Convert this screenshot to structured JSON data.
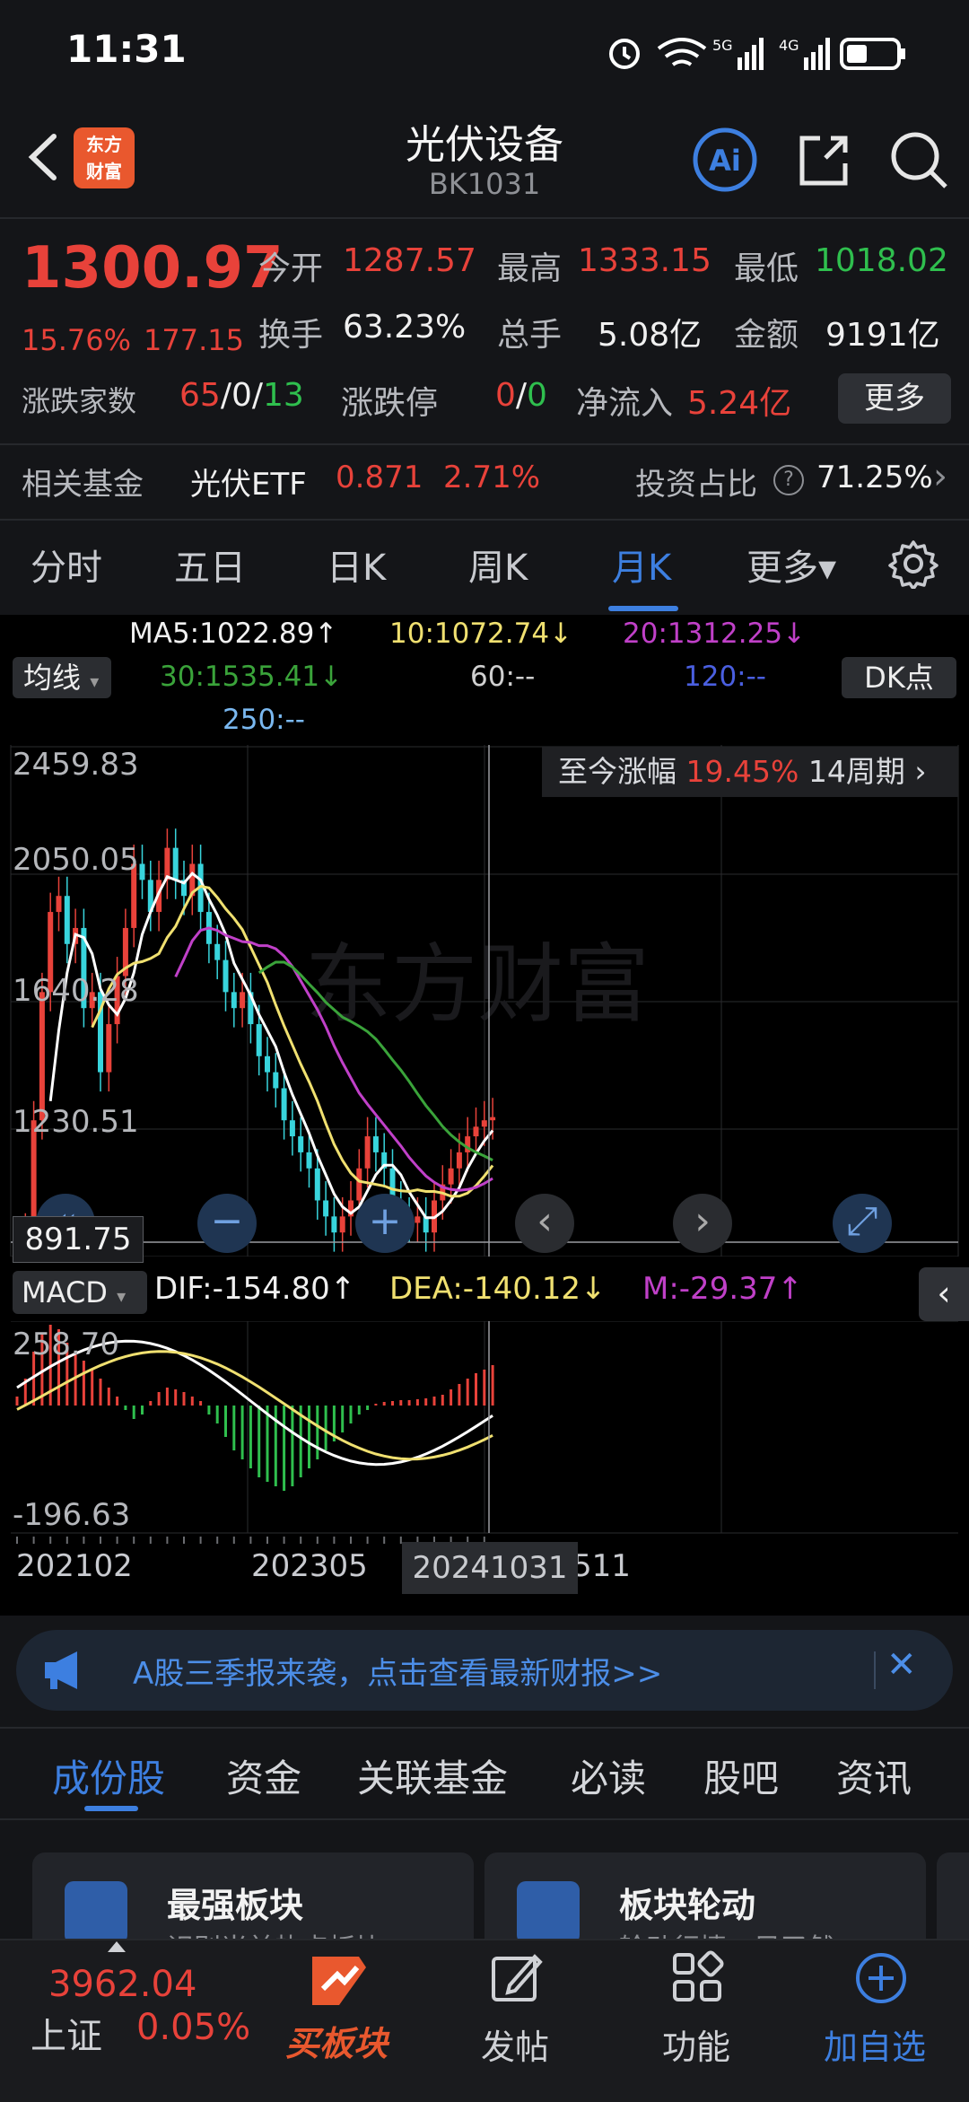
{
  "status": {
    "time": "11:31"
  },
  "header": {
    "title": "光伏设备",
    "code": "BK1031",
    "logo_line1": "东方",
    "logo_line2": "财富",
    "ai_label": "Ai"
  },
  "quote": {
    "price": "1300.97",
    "change_pct": "15.76%",
    "change": "177.15",
    "open_label": "今开",
    "open": "1287.57",
    "high_label": "最高",
    "high": "1333.15",
    "low_label": "最低",
    "low": "1018.02",
    "turnover_label": "换手",
    "turnover": "63.23%",
    "volume_label": "总手",
    "volume": "5.08亿",
    "amount_label": "金额",
    "amount": "9191亿",
    "breadth_label": "涨跌家数",
    "up_count": "65",
    "flat_count": "0",
    "down_count": "13",
    "sep": "/",
    "limit_label": "涨跌停",
    "limit_up": "0",
    "limit_down": "0",
    "netflow_label": "净流入",
    "netflow": "5.24亿",
    "more_button": "更多"
  },
  "fund": {
    "label": "相关基金",
    "name": "光伏ETF",
    "price": "0.871",
    "pct": "2.71%",
    "ratio_label": "投资占比",
    "help": "?",
    "ratio": "71.25%",
    "arrow": "›"
  },
  "period_tabs": [
    "分时",
    "五日",
    "日K",
    "周K",
    "月K",
    "更多▾"
  ],
  "ma": {
    "toggle": "均线",
    "ma5": "MA5:1022.89↑",
    "ma10": "10:1072.74↓",
    "ma20": "20:1312.25↓",
    "ma30": "30:1535.41↓",
    "ma60": "60:--",
    "ma120": "120:--",
    "ma250": "250:--",
    "dk": "DK点"
  },
  "since": {
    "label": "至今涨幅",
    "pct": "19.45%",
    "periods": "14周期",
    "arrow": "›"
  },
  "yaxis": [
    "2459.83",
    "2050.05",
    "1640.28",
    "1230.51"
  ],
  "price_tag": "891.75",
  "macd": {
    "toggle": "MACD",
    "dif": "DIF:-154.80↑",
    "dea": "DEA:-140.12↓",
    "m": "M:-29.37↑",
    "top": "258.70",
    "bottom": "-196.63",
    "collapse": "‹"
  },
  "xaxis": {
    "start": "202102",
    "mid": "202305",
    "cursor": "20241031",
    "end": "511"
  },
  "banner": {
    "text": "A股三季报来袭，点击查看最新财报>>",
    "close": "✕"
  },
  "bottom_tabs": [
    "成份股",
    "资金",
    "关联基金",
    "必读",
    "股吧",
    "资讯"
  ],
  "cards": [
    {
      "title": "最强板块",
      "sub": "识别当前热点板块"
    },
    {
      "title": "板块轮动",
      "sub": "轮动行情一目了然"
    }
  ],
  "bottom_nav": {
    "index_value": "3962.04",
    "index_name": "上证",
    "index_pct": "0.05%",
    "buy_label": "买板块",
    "post_label": "发帖",
    "func_label": "功能",
    "add_label": "加自选"
  },
  "colors": {
    "up": "#e8423a",
    "down": "#2fbf4e",
    "accent": "#3d7fe0",
    "ma5": "#ffffff",
    "ma10": "#f0e070",
    "ma20": "#c040c8",
    "ma30": "#3aa33a"
  },
  "chart_data": [
    {
      "type": "candlestick",
      "title": "",
      "ylim": [
        891.75,
        2459.83
      ],
      "y_ticks": [
        2459.83,
        2050.05,
        1640.28,
        1230.51
      ],
      "x_ticks": [
        "202102",
        "202305",
        "20241031"
      ],
      "series": [
        {
          "name": "MA5",
          "value": 1022.89
        },
        {
          "name": "MA10",
          "value": 1072.74
        },
        {
          "name": "MA20",
          "value": 1312.25
        },
        {
          "name": "MA30",
          "value": 1535.41
        }
      ]
    },
    {
      "type": "bar",
      "title": "",
      "ylim": [
        -196.63,
        258.7
      ],
      "series": [
        {
          "name": "DIF",
          "value": -154.8
        },
        {
          "name": "DEA",
          "value": -140.12
        },
        {
          "name": "M",
          "value": -29.37
        }
      ]
    }
  ]
}
